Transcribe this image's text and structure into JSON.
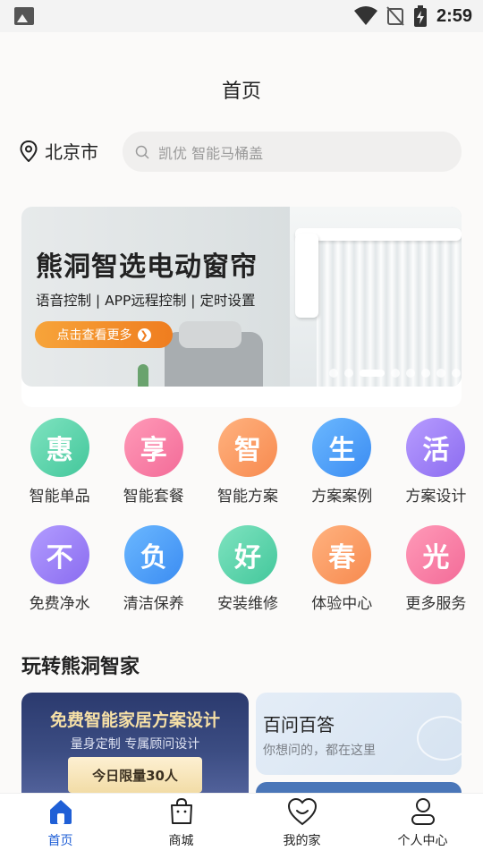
{
  "status_bar": {
    "time": "2:59",
    "icons": [
      "image-icon",
      "wifi-icon",
      "no-signal-icon",
      "battery-charging-icon"
    ]
  },
  "header": {
    "title": "首页"
  },
  "location": {
    "city": "北京市",
    "icon": "location-pin-icon"
  },
  "search": {
    "placeholder": "凯优 智能马桶盖",
    "icon": "search-icon"
  },
  "banner": {
    "title": "熊洞智选电动窗帘",
    "subtitle": "语音控制 | APP远程控制 | 定时设置",
    "button_label": "点击查看更多",
    "dot_count": 8,
    "active_dot_index": 2,
    "accent_color": "#f28a27"
  },
  "services": [
    {
      "glyph": "惠",
      "label": "智能单品",
      "color_from": "#7fe3c0",
      "color_to": "#43c79b"
    },
    {
      "glyph": "享",
      "label": "智能套餐",
      "color_from": "#ff9ab8",
      "color_to": "#f36b98"
    },
    {
      "glyph": "智",
      "label": "智能方案",
      "color_from": "#ffb27f",
      "color_to": "#f78a4f"
    },
    {
      "glyph": "生",
      "label": "方案案例",
      "color_from": "#6bb8ff",
      "color_to": "#3b8cf2"
    },
    {
      "glyph": "活",
      "label": "方案设计",
      "color_from": "#b79cff",
      "color_to": "#8c6cf0"
    },
    {
      "glyph": "不",
      "label": "免费净水",
      "color_from": "#b29cff",
      "color_to": "#8a6cf0"
    },
    {
      "glyph": "负",
      "label": "清洁保养",
      "color_from": "#6bb8ff",
      "color_to": "#3b8cf2"
    },
    {
      "glyph": "好",
      "label": "安装维修",
      "color_from": "#7fe3c0",
      "color_to": "#43c79b"
    },
    {
      "glyph": "春",
      "label": "体验中心",
      "color_from": "#ffb27f",
      "color_to": "#f78a4f"
    },
    {
      "glyph": "光",
      "label": "更多服务",
      "color_from": "#ff9ab8",
      "color_to": "#f36b98"
    }
  ],
  "section": {
    "title": "玩转熊洞智家",
    "promo_left": {
      "title": "免费智能家居方案设计",
      "subtitle": "量身定制 专属顾问设计",
      "badge": "今日限量30人"
    },
    "promo_right": {
      "title": "百问百答",
      "subtitle": "你想问的，都在这里"
    }
  },
  "bottom_nav": {
    "active_color": "#1f5fd6",
    "items": [
      {
        "label": "首页",
        "icon": "home-icon",
        "active": true
      },
      {
        "label": "商城",
        "icon": "shopping-bag-icon",
        "active": false
      },
      {
        "label": "我的家",
        "icon": "heart-icon",
        "active": false
      },
      {
        "label": "个人中心",
        "icon": "person-icon",
        "active": false
      }
    ]
  }
}
